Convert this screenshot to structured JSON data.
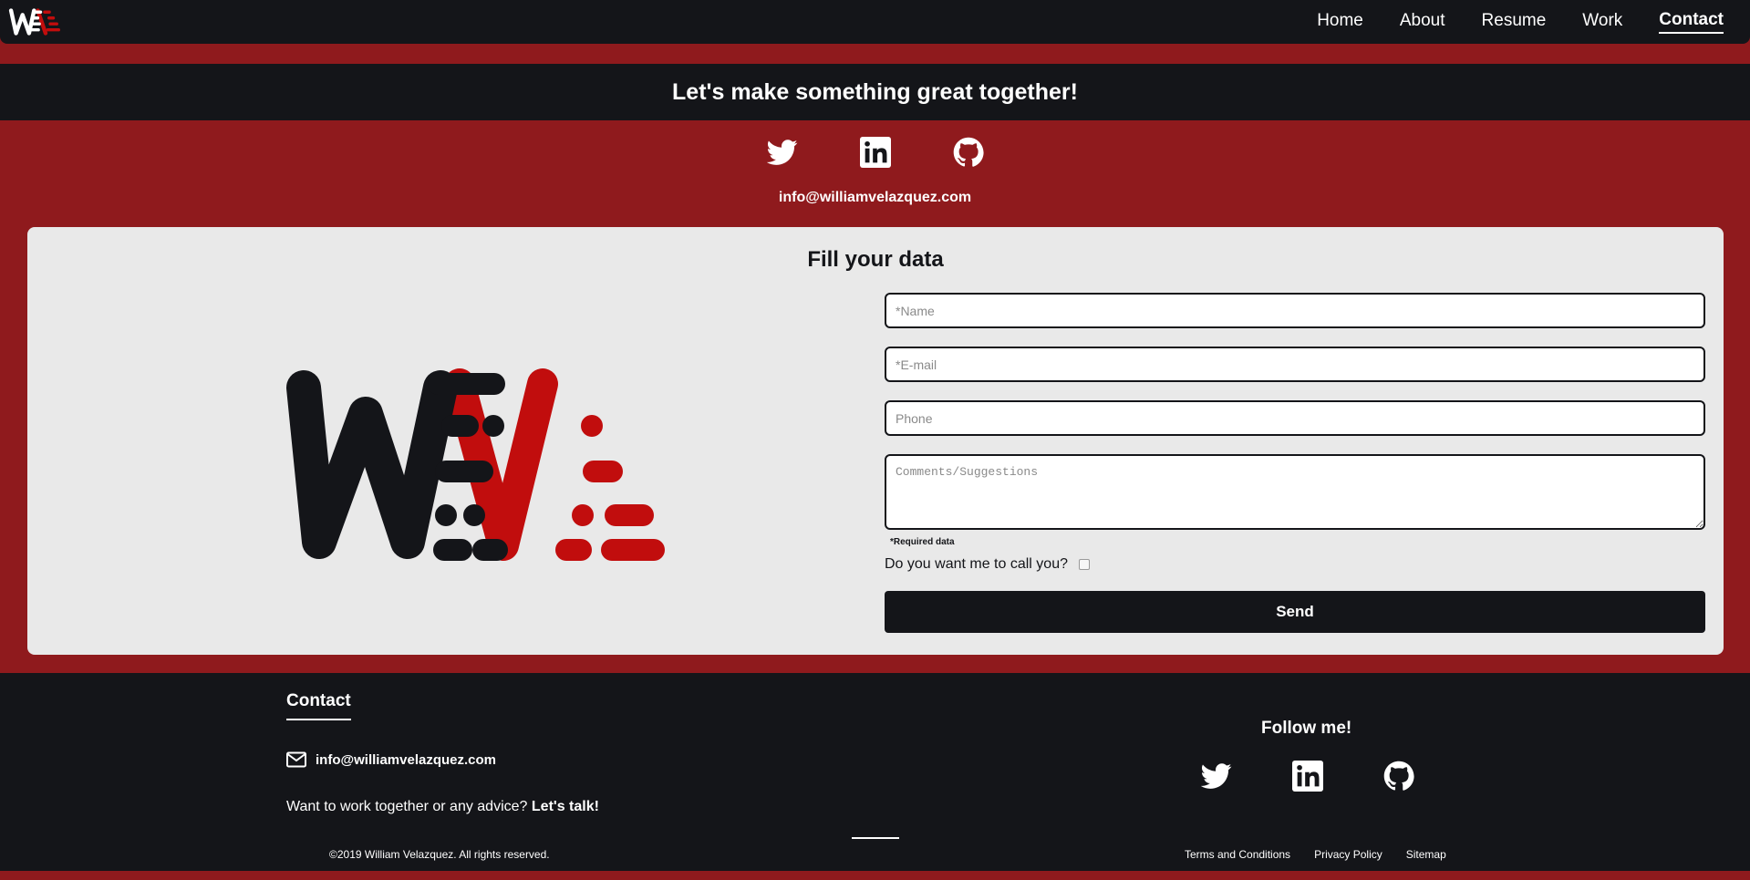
{
  "nav": {
    "logo_icon": "we-logo-icon",
    "links": [
      {
        "label": "Home",
        "active": false
      },
      {
        "label": "About",
        "active": false
      },
      {
        "label": "Resume",
        "active": false
      },
      {
        "label": "Work",
        "active": false
      },
      {
        "label": "Contact",
        "active": true
      }
    ]
  },
  "hero": {
    "title": "Let's make something great together!"
  },
  "social": {
    "icons": [
      "twitter-icon",
      "linkedin-icon",
      "github-icon"
    ]
  },
  "contact_email": "info@williamvelazquez.com",
  "form": {
    "title": "Fill your data",
    "name_placeholder": "*Name",
    "email_placeholder": "*E-mail",
    "phone_placeholder": "Phone",
    "comments_placeholder": "Comments/Suggestions",
    "required_note": "*Required data",
    "call_label": "Do you want me to call you?",
    "send_label": "Send"
  },
  "footer": {
    "contact_title": "Contact",
    "email": "info@williamvelazquez.com",
    "talk_text": "Want to work together or any advice?",
    "talk_cta": "Let's talk!",
    "follow_title": "Follow me!",
    "copyright": "©2019 William Velazquez. All rights reserved.",
    "legal": [
      "Terms and Conditions",
      "Privacy Policy",
      "Sitemap"
    ]
  },
  "colors": {
    "dark": "#141519",
    "brand_red": "#8f1a1d",
    "logo_red": "#c10d0d",
    "card_bg": "#e9e9e9"
  }
}
